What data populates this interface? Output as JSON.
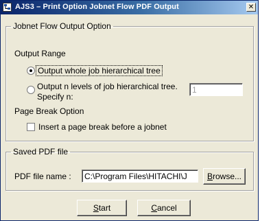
{
  "window": {
    "title": "AJS3 – Print Option Jobnet Flow PDF Output",
    "close_glyph": "✕"
  },
  "output_option": {
    "legend": "Jobnet Flow Output Option",
    "range_label": "Output Range",
    "radio_whole": {
      "label": "Output whole job hierarchical tree",
      "checked": true
    },
    "radio_levels": {
      "label_line1": "Output n levels of job hierarchical tree.",
      "label_line2": "Specify n:",
      "checked": false
    },
    "levels_value": "1",
    "page_break_label": "Page Break Option",
    "page_break_checkbox": {
      "label": "Insert a page break before a jobnet",
      "checked": false
    }
  },
  "saved_pdf": {
    "legend": "Saved PDF file",
    "file_label": "PDF file name :",
    "file_value": "C:\\Program Files\\HITACHI\\J",
    "browse_prefix": "B",
    "browse_rest": "rowse..."
  },
  "buttons": {
    "start_prefix": "S",
    "start_rest": "tart",
    "cancel_prefix": "C",
    "cancel_rest": "ancel"
  },
  "colors": {
    "titlebar_start": "#0a246a",
    "titlebar_end": "#a6caf0",
    "dialog_bg": "#ece9d8"
  }
}
